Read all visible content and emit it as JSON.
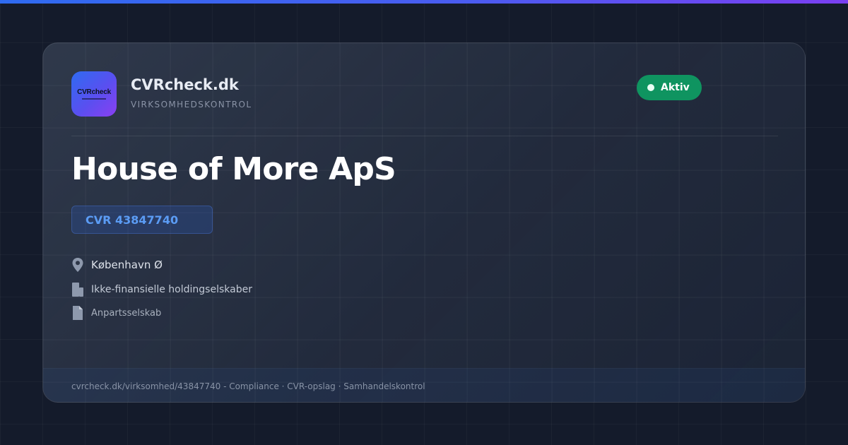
{
  "brand": {
    "logo_text": "CVRcheck",
    "name": "CVRcheck.dk",
    "tagline": "VIRKSOMHEDSKONTROL"
  },
  "status": {
    "label": "Aktiv",
    "color": "#0f9460"
  },
  "company": {
    "name": "House of More ApS",
    "cvr_label": "CVR 43847740"
  },
  "details": {
    "city": "København Ø",
    "industry": "Ikke-finansielle holdingselskaber",
    "company_type": "Anpartsselskab"
  },
  "footer": {
    "text": "cvrcheck.dk/virksomhed/43847740 - Compliance · CVR-opslag · Samhandelskontrol"
  },
  "icons": {
    "city": "location-pin-icon",
    "industry": "building-icon",
    "company_type": "document-icon"
  },
  "colors": {
    "accent_blue": "#5b9cf5",
    "background": "#141b2b",
    "top_bar_start": "#2f6bf0",
    "top_bar_end": "#7b3ff2"
  }
}
